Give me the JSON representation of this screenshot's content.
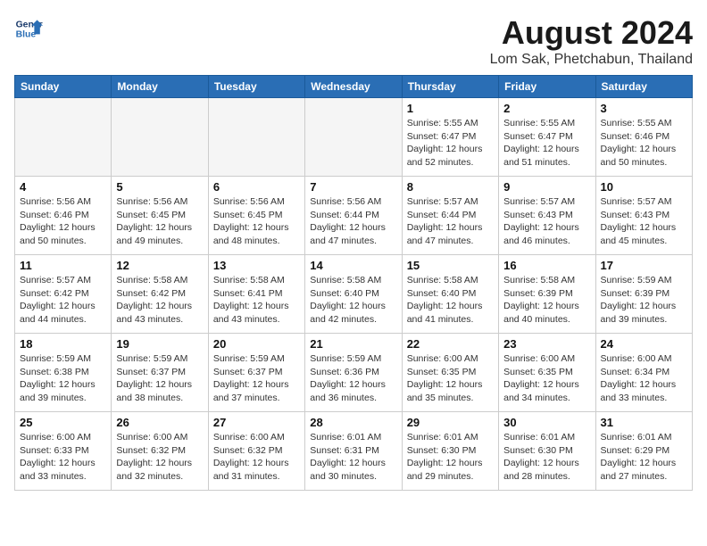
{
  "logo": {
    "line1": "General",
    "line2": "Blue"
  },
  "title": "August 2024",
  "location": "Lom Sak, Phetchabun, Thailand",
  "days_of_week": [
    "Sunday",
    "Monday",
    "Tuesday",
    "Wednesday",
    "Thursday",
    "Friday",
    "Saturday"
  ],
  "weeks": [
    [
      {
        "day": "",
        "info": "",
        "empty": true
      },
      {
        "day": "",
        "info": "",
        "empty": true
      },
      {
        "day": "",
        "info": "",
        "empty": true
      },
      {
        "day": "",
        "info": "",
        "empty": true
      },
      {
        "day": "1",
        "info": "Sunrise: 5:55 AM\nSunset: 6:47 PM\nDaylight: 12 hours\nand 52 minutes."
      },
      {
        "day": "2",
        "info": "Sunrise: 5:55 AM\nSunset: 6:47 PM\nDaylight: 12 hours\nand 51 minutes."
      },
      {
        "day": "3",
        "info": "Sunrise: 5:55 AM\nSunset: 6:46 PM\nDaylight: 12 hours\nand 50 minutes."
      }
    ],
    [
      {
        "day": "4",
        "info": "Sunrise: 5:56 AM\nSunset: 6:46 PM\nDaylight: 12 hours\nand 50 minutes."
      },
      {
        "day": "5",
        "info": "Sunrise: 5:56 AM\nSunset: 6:45 PM\nDaylight: 12 hours\nand 49 minutes."
      },
      {
        "day": "6",
        "info": "Sunrise: 5:56 AM\nSunset: 6:45 PM\nDaylight: 12 hours\nand 48 minutes."
      },
      {
        "day": "7",
        "info": "Sunrise: 5:56 AM\nSunset: 6:44 PM\nDaylight: 12 hours\nand 47 minutes."
      },
      {
        "day": "8",
        "info": "Sunrise: 5:57 AM\nSunset: 6:44 PM\nDaylight: 12 hours\nand 47 minutes."
      },
      {
        "day": "9",
        "info": "Sunrise: 5:57 AM\nSunset: 6:43 PM\nDaylight: 12 hours\nand 46 minutes."
      },
      {
        "day": "10",
        "info": "Sunrise: 5:57 AM\nSunset: 6:43 PM\nDaylight: 12 hours\nand 45 minutes."
      }
    ],
    [
      {
        "day": "11",
        "info": "Sunrise: 5:57 AM\nSunset: 6:42 PM\nDaylight: 12 hours\nand 44 minutes."
      },
      {
        "day": "12",
        "info": "Sunrise: 5:58 AM\nSunset: 6:42 PM\nDaylight: 12 hours\nand 43 minutes."
      },
      {
        "day": "13",
        "info": "Sunrise: 5:58 AM\nSunset: 6:41 PM\nDaylight: 12 hours\nand 43 minutes."
      },
      {
        "day": "14",
        "info": "Sunrise: 5:58 AM\nSunset: 6:40 PM\nDaylight: 12 hours\nand 42 minutes."
      },
      {
        "day": "15",
        "info": "Sunrise: 5:58 AM\nSunset: 6:40 PM\nDaylight: 12 hours\nand 41 minutes."
      },
      {
        "day": "16",
        "info": "Sunrise: 5:58 AM\nSunset: 6:39 PM\nDaylight: 12 hours\nand 40 minutes."
      },
      {
        "day": "17",
        "info": "Sunrise: 5:59 AM\nSunset: 6:39 PM\nDaylight: 12 hours\nand 39 minutes."
      }
    ],
    [
      {
        "day": "18",
        "info": "Sunrise: 5:59 AM\nSunset: 6:38 PM\nDaylight: 12 hours\nand 39 minutes."
      },
      {
        "day": "19",
        "info": "Sunrise: 5:59 AM\nSunset: 6:37 PM\nDaylight: 12 hours\nand 38 minutes."
      },
      {
        "day": "20",
        "info": "Sunrise: 5:59 AM\nSunset: 6:37 PM\nDaylight: 12 hours\nand 37 minutes."
      },
      {
        "day": "21",
        "info": "Sunrise: 5:59 AM\nSunset: 6:36 PM\nDaylight: 12 hours\nand 36 minutes."
      },
      {
        "day": "22",
        "info": "Sunrise: 6:00 AM\nSunset: 6:35 PM\nDaylight: 12 hours\nand 35 minutes."
      },
      {
        "day": "23",
        "info": "Sunrise: 6:00 AM\nSunset: 6:35 PM\nDaylight: 12 hours\nand 34 minutes."
      },
      {
        "day": "24",
        "info": "Sunrise: 6:00 AM\nSunset: 6:34 PM\nDaylight: 12 hours\nand 33 minutes."
      }
    ],
    [
      {
        "day": "25",
        "info": "Sunrise: 6:00 AM\nSunset: 6:33 PM\nDaylight: 12 hours\nand 33 minutes."
      },
      {
        "day": "26",
        "info": "Sunrise: 6:00 AM\nSunset: 6:32 PM\nDaylight: 12 hours\nand 32 minutes."
      },
      {
        "day": "27",
        "info": "Sunrise: 6:00 AM\nSunset: 6:32 PM\nDaylight: 12 hours\nand 31 minutes."
      },
      {
        "day": "28",
        "info": "Sunrise: 6:01 AM\nSunset: 6:31 PM\nDaylight: 12 hours\nand 30 minutes."
      },
      {
        "day": "29",
        "info": "Sunrise: 6:01 AM\nSunset: 6:30 PM\nDaylight: 12 hours\nand 29 minutes."
      },
      {
        "day": "30",
        "info": "Sunrise: 6:01 AM\nSunset: 6:30 PM\nDaylight: 12 hours\nand 28 minutes."
      },
      {
        "day": "31",
        "info": "Sunrise: 6:01 AM\nSunset: 6:29 PM\nDaylight: 12 hours\nand 27 minutes."
      }
    ]
  ]
}
